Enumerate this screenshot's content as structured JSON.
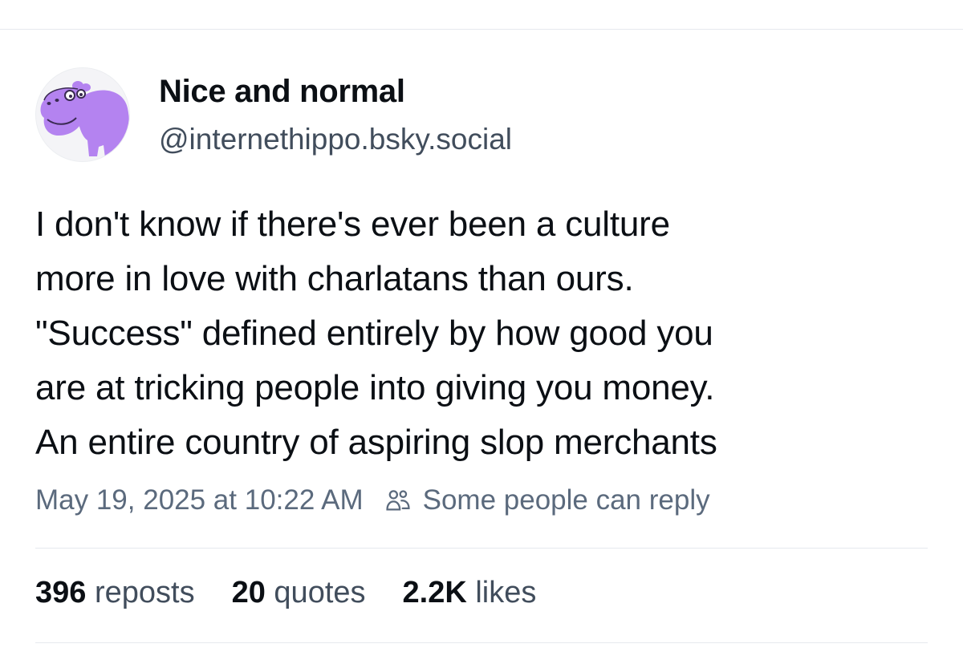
{
  "author": {
    "display_name": "Nice and normal",
    "handle": "@internethippo.bsky.social",
    "avatar_icon": "hippo-avatar-icon"
  },
  "post": {
    "lines": [
      "I don't know if there's ever been a culture",
      "more in love with charlatans than ours.",
      "\"Success\" defined entirely by how good you",
      "are at tricking people into giving you money.",
      "An entire country of aspiring slop merchants"
    ],
    "timestamp": "May 19, 2025 at 10:22 AM",
    "reply_setting": "Some people can reply",
    "reply_icon": "people-icon"
  },
  "stats": {
    "reposts": {
      "count": "396",
      "label": "reposts"
    },
    "quotes": {
      "count": "20",
      "label": "quotes"
    },
    "likes": {
      "count": "2.2K",
      "label": "likes"
    }
  },
  "colors": {
    "text": "#0b0f14",
    "secondary": "#5b6a7d",
    "handle": "#414d5c",
    "divider": "#e6e9ee",
    "hippo": "#b483f0"
  }
}
